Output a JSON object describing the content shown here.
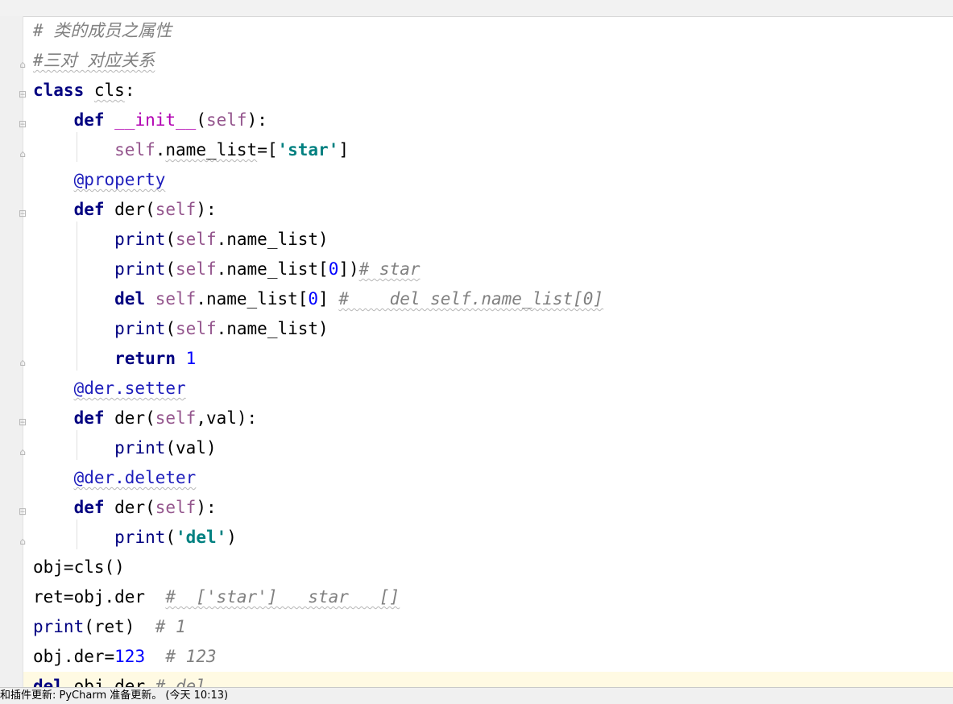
{
  "editor": {
    "lines": [
      [
        {
          "t": "# 类的成员之属性",
          "c": "cmt"
        }
      ],
      [
        {
          "t": "#三对 对应关系",
          "c": "cmt wavy"
        }
      ],
      [
        {
          "t": "class",
          "c": "kw"
        },
        {
          "t": " "
        },
        {
          "t": "cls",
          "c": "wavy"
        },
        {
          "t": ":"
        }
      ],
      [
        {
          "t": "    "
        },
        {
          "t": "def",
          "c": "kw"
        },
        {
          "t": " "
        },
        {
          "t": "__init__",
          "c": "dunder"
        },
        {
          "t": "("
        },
        {
          "t": "self",
          "c": "self"
        },
        {
          "t": "):"
        }
      ],
      [
        {
          "t": "        "
        },
        {
          "t": "self",
          "c": "self"
        },
        {
          "t": "."
        },
        {
          "t": "name_list",
          "c": "wavy"
        },
        {
          "t": "=["
        },
        {
          "t": "'star'",
          "c": "str"
        },
        {
          "t": "]"
        }
      ],
      [
        {
          "t": "    "
        },
        {
          "t": "@property",
          "c": "deco wavy"
        }
      ],
      [
        {
          "t": "    "
        },
        {
          "t": "def",
          "c": "kw"
        },
        {
          "t": " der("
        },
        {
          "t": "self",
          "c": "self"
        },
        {
          "t": "):"
        }
      ],
      [
        {
          "t": "        "
        },
        {
          "t": "print",
          "c": "builtin"
        },
        {
          "t": "("
        },
        {
          "t": "self",
          "c": "self"
        },
        {
          "t": ".name_list)"
        }
      ],
      [
        {
          "t": "        "
        },
        {
          "t": "print",
          "c": "builtin"
        },
        {
          "t": "("
        },
        {
          "t": "self",
          "c": "self"
        },
        {
          "t": ".name_list["
        },
        {
          "t": "0",
          "c": "num"
        },
        {
          "t": "])"
        },
        {
          "t": "# star",
          "c": "cmt wavy"
        }
      ],
      [
        {
          "t": "        "
        },
        {
          "t": "del",
          "c": "kw"
        },
        {
          "t": " "
        },
        {
          "t": "self",
          "c": "self"
        },
        {
          "t": ".name_list["
        },
        {
          "t": "0",
          "c": "num"
        },
        {
          "t": "] "
        },
        {
          "t": "#    del self.name_list[0]",
          "c": "cmt wavy"
        }
      ],
      [
        {
          "t": "        "
        },
        {
          "t": "print",
          "c": "builtin"
        },
        {
          "t": "("
        },
        {
          "t": "self",
          "c": "self"
        },
        {
          "t": ".name_list)"
        }
      ],
      [
        {
          "t": "        "
        },
        {
          "t": "return",
          "c": "kw"
        },
        {
          "t": " "
        },
        {
          "t": "1",
          "c": "num"
        }
      ],
      [
        {
          "t": "    "
        },
        {
          "t": "@der.setter",
          "c": "deco wavy"
        }
      ],
      [
        {
          "t": "    "
        },
        {
          "t": "def",
          "c": "kw"
        },
        {
          "t": " der("
        },
        {
          "t": "self",
          "c": "self"
        },
        {
          "t": ",val):"
        }
      ],
      [
        {
          "t": "        "
        },
        {
          "t": "print",
          "c": "builtin"
        },
        {
          "t": "(val)"
        }
      ],
      [
        {
          "t": "    "
        },
        {
          "t": "@der.deleter",
          "c": "deco wavy"
        }
      ],
      [
        {
          "t": "    "
        },
        {
          "t": "def",
          "c": "kw"
        },
        {
          "t": " der("
        },
        {
          "t": "self",
          "c": "self"
        },
        {
          "t": "):"
        }
      ],
      [
        {
          "t": "        "
        },
        {
          "t": "print",
          "c": "builtin"
        },
        {
          "t": "("
        },
        {
          "t": "'del'",
          "c": "str"
        },
        {
          "t": ")"
        }
      ],
      [
        {
          "t": "obj=cls()"
        }
      ],
      [
        {
          "t": "ret=obj.der  "
        },
        {
          "t": "#  ['star']   star   []",
          "c": "cmt wavy"
        }
      ],
      [
        {
          "t": "print",
          "c": "builtin"
        },
        {
          "t": "(ret)  "
        },
        {
          "t": "# 1",
          "c": "cmt"
        }
      ],
      [
        {
          "t": "obj.der="
        },
        {
          "t": "123",
          "c": "num"
        },
        {
          "t": "  "
        },
        {
          "t": "# 123",
          "c": "cmt"
        }
      ],
      [
        {
          "t": "del",
          "c": "kw"
        },
        {
          "t": " obj.der "
        },
        {
          "t": "# del",
          "c": "cmt"
        }
      ]
    ],
    "current_line": 22
  },
  "status": {
    "message": "和插件更新: PyCharm 准备更新。 (今天 10:13)"
  }
}
